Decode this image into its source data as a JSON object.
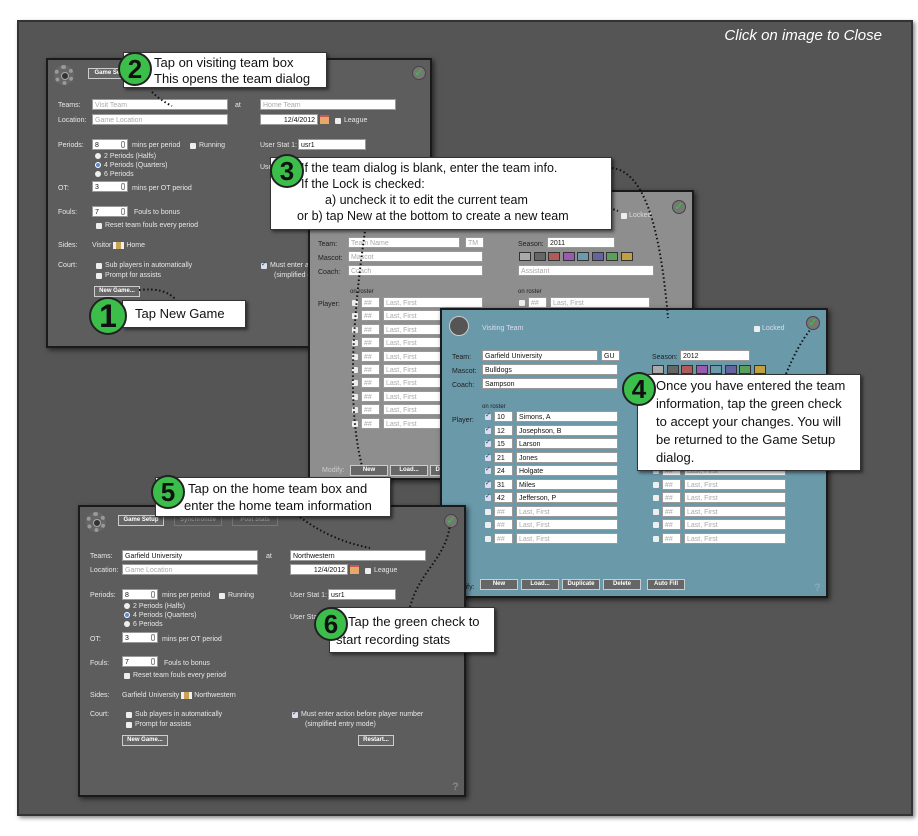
{
  "close_hint": "Click on image to Close",
  "colors": {
    "frame": "#555555",
    "setup_panel": "#5d5d5d",
    "team_panel_blank": "#8e8e8e",
    "team_panel_filled": "#6a99aa",
    "callout_badge": "#3bbf4a",
    "check": "#33cc33"
  },
  "setup_blank": {
    "tab_game_setup": "Game Setup",
    "teams_label": "Teams:",
    "visit_placeholder": "Visit Team",
    "at": "at",
    "home_placeholder": "Home Team",
    "location_label": "Location:",
    "location_placeholder": "Game Location",
    "date": "12/4/2012",
    "league": "League",
    "periods_label": "Periods:",
    "periods_value": "8",
    "mins_per_period": "mins per period",
    "running": "Running",
    "radio_2": "2 Periods (Halfs)",
    "radio_4": "4 Periods (Quarters)",
    "radio_6": "6 Periods",
    "user_stat1_label": "User Stat 1:",
    "user_stat1_value": "usr1",
    "user_stat2_label": "User Stat 2:",
    "ot_label": "OT:",
    "ot_value": "3",
    "mins_per_ot": "mins per OT period",
    "fouls_label": "Fouls:",
    "fouls_value": "7",
    "fouls_to_bonus": "Fouls to bonus",
    "reset_fouls": "Reset team fouls every period",
    "sides_label": "Sides:",
    "side_left": "Visitor",
    "side_right": "Home",
    "court_label": "Court:",
    "sub_auto": "Sub players in automatically",
    "prompt_assists": "Prompt for assists",
    "must_enter": "Must enter action before player number",
    "simplified": "(simplified entry mode)",
    "new_game": "New Game..."
  },
  "team_blank": {
    "locked": "Locked",
    "team_label": "Team:",
    "team_placeholder": "Team Name",
    "abbr_placeholder": "TM",
    "season_label": "Season:",
    "season_value": "2011",
    "mascot_label": "Mascot:",
    "mascot_placeholder": "Mascot",
    "coach_label": "Coach:",
    "coach_placeholder": "Coach",
    "assistant_placeholder": "Assistant",
    "on_roster": "on roster",
    "player_label": "Player:",
    "num_placeholder": "##",
    "name_placeholder": "Last, First",
    "modify_label": "Modify:",
    "buttons": [
      "New",
      "Load...",
      "Duplicate"
    ]
  },
  "team_filled": {
    "title": "Visiting Team",
    "locked": "Locked",
    "team_label": "Team:",
    "team_value": "Garfield University",
    "abbr_value": "GU",
    "season_label": "Season:",
    "season_value": "2012",
    "mascot_label": "Mascot:",
    "mascot_value": "Bulldogs",
    "coach_label": "Coach:",
    "coach_value": "Sampson",
    "on_roster": "on roster",
    "player_label": "Player:",
    "num_placeholder": "##",
    "name_placeholder": "Last, First",
    "players": [
      {
        "num": "10",
        "name": "Simons, A"
      },
      {
        "num": "12",
        "name": "Josephson, B"
      },
      {
        "num": "15",
        "name": "Larson"
      },
      {
        "num": "21",
        "name": "Jones"
      },
      {
        "num": "24",
        "name": "Holgate"
      },
      {
        "num": "31",
        "name": "Miles"
      },
      {
        "num": "42",
        "name": "Jefferson, P"
      }
    ],
    "modify_label": "Modify:",
    "buttons": [
      "New",
      "Load...",
      "Duplicate",
      "Delete",
      "Auto Fill"
    ],
    "help": "?"
  },
  "swatches": [
    "#aaaaaa",
    "#666666",
    "#b05a5a",
    "#9a5ab0",
    "#6a9aab",
    "#6464a0",
    "#5aa05a",
    "#c0a040"
  ],
  "setup_filled": {
    "tab_game_setup": "Game Setup",
    "tab_sync": "Synchronize",
    "tab_post": "Post Stats",
    "teams_label": "Teams:",
    "visit_value": "Garfield University",
    "at": "at",
    "home_value": "Northwestern",
    "location_label": "Location:",
    "location_placeholder": "Game Location",
    "date": "12/4/2012",
    "league": "League",
    "periods_label": "Periods:",
    "periods_value": "8",
    "mins_per_period": "mins per period",
    "running": "Running",
    "radio_2": "2 Periods (Halfs)",
    "radio_4": "4 Periods (Quarters)",
    "radio_6": "6 Periods",
    "user_stat1_label": "User Stat 1:",
    "user_stat1_value": "usr1",
    "user_stat2_label": "User Stat 2:",
    "ot_label": "OT:",
    "ot_value": "3",
    "mins_per_ot": "mins per OT period",
    "fouls_label": "Fouls:",
    "fouls_value": "7",
    "fouls_to_bonus": "Fouls to bonus",
    "reset_fouls": "Reset team fouls every period",
    "sides_label": "Sides:",
    "side_left": "Garfield University",
    "side_right": "Northwestern",
    "court_label": "Court:",
    "sub_auto": "Sub players in automatically",
    "prompt_assists": "Prompt for assists",
    "must_enter": "Must enter action before player number",
    "simplified": "(simplified entry mode)",
    "new_game": "New Game...",
    "restart": "Restart...",
    "help": "?"
  },
  "callouts": [
    {
      "n": "1",
      "lines": [
        "Tap New Game"
      ]
    },
    {
      "n": "2",
      "lines": [
        "Tap on visiting team box",
        "This opens the team dialog"
      ]
    },
    {
      "n": "3",
      "lines": [
        "If the team dialog is blank, enter the team info.",
        "If the Lock is checked:",
        "a) uncheck it to edit the current team",
        "or  b) tap New at the bottom to create a new team"
      ]
    },
    {
      "n": "4",
      "lines": [
        "Once you have entered the team",
        "information, tap the green check",
        "to accept your changes.  You will",
        "be returned to the Game Setup",
        "dialog."
      ]
    },
    {
      "n": "5",
      "lines": [
        "Tap on the home team box and",
        "enter the home team information"
      ]
    },
    {
      "n": "6",
      "lines": [
        "Tap the green check to",
        "start recording stats"
      ]
    }
  ]
}
